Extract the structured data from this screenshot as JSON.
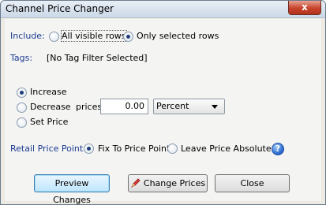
{
  "window": {
    "title": "Channel Price Changer",
    "close_glyph": "x"
  },
  "include": {
    "label": "Include:",
    "options": [
      {
        "label": "All visible rows",
        "selected": false
      },
      {
        "label": "Only selected rows",
        "selected": true
      }
    ]
  },
  "tags": {
    "label": "Tags:",
    "value": "[No Tag Filter Selected]"
  },
  "action": {
    "options": [
      {
        "label": "Increase",
        "selected": true
      },
      {
        "label": "Decrease",
        "selected": false
      },
      {
        "label": "Set Price",
        "selected": false
      }
    ],
    "prices_label": "prices",
    "amount_value": "0.00",
    "mode_selected": "Percent"
  },
  "retail": {
    "label": "Retail Price Point:",
    "options": [
      {
        "label": "Fix To Price Point",
        "selected": true
      },
      {
        "label": "Leave Price Absolute",
        "selected": false
      }
    ],
    "help_glyph": "?"
  },
  "buttons": {
    "preview": "Preview Changes",
    "change": "Change Prices",
    "close": "Close"
  },
  "colors": {
    "label_blue": "#1b3a8f",
    "default_button_border": "#3c7fb1",
    "close_red": "#c7432b"
  },
  "icons": {
    "help": "help-icon",
    "change": "pen-icon",
    "close": "close-icon"
  }
}
